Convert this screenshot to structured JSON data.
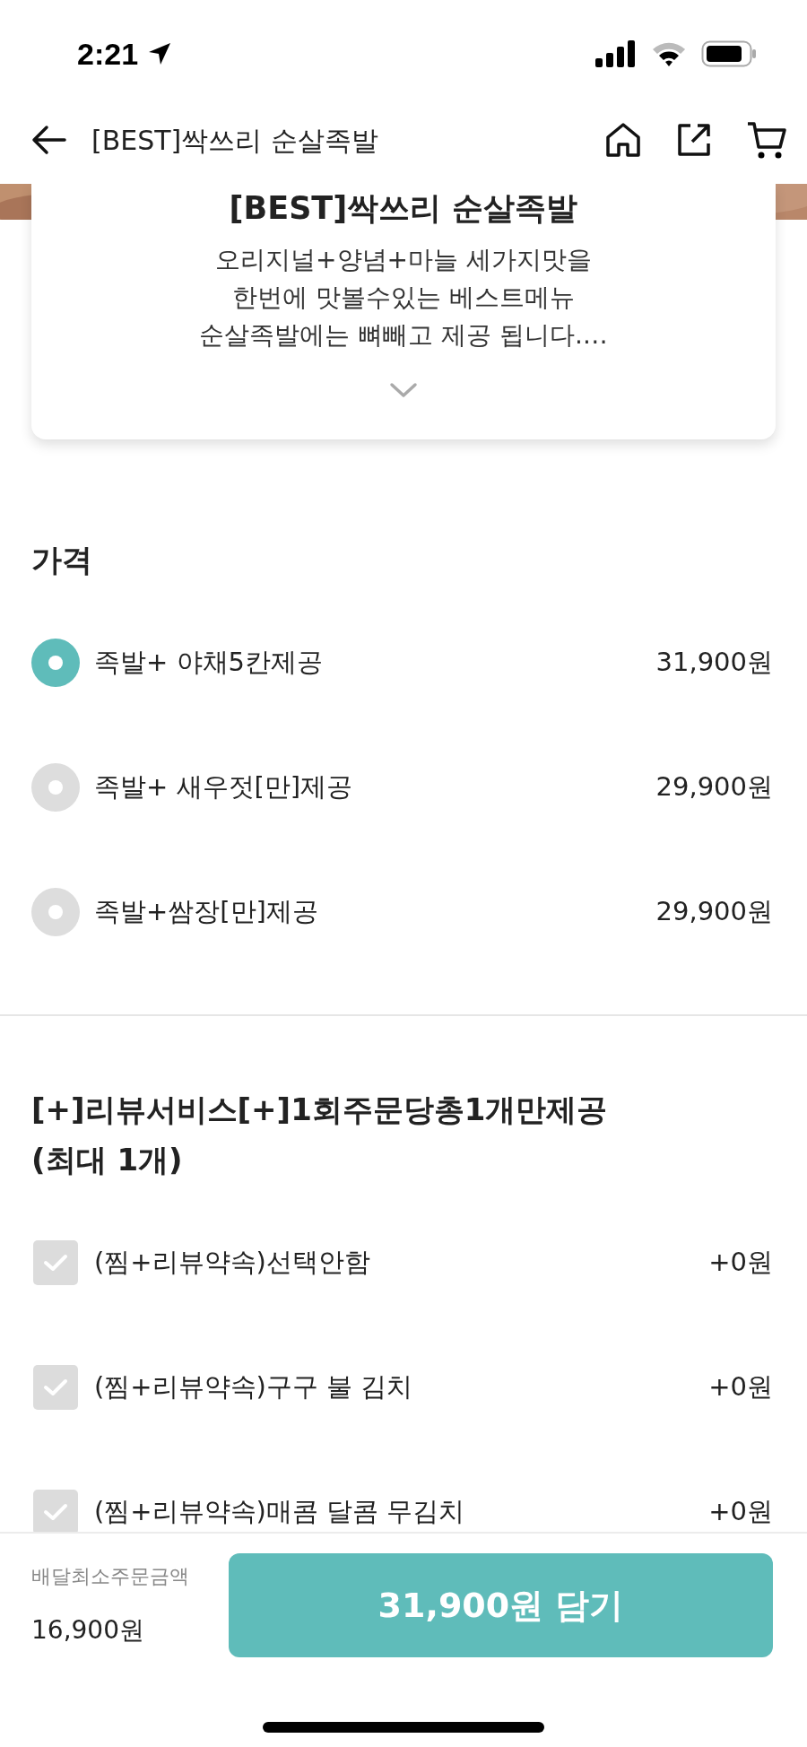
{
  "status_bar": {
    "time": "2:21"
  },
  "header": {
    "title": "[BEST]싹쓰리 순살족발"
  },
  "menu_card": {
    "title": "[BEST]싹쓰리 순살족발",
    "description": [
      "오리지널+양념+마늘 세가지맛을",
      "한번에 맛볼수있는 베스트메뉴",
      "순살족발에는 뼈빼고 제공 됩니다.…"
    ],
    "expanded": false
  },
  "option_groups": [
    {
      "kind": "radio",
      "title": "가격",
      "options": [
        {
          "label": "족발+ 야채5칸제공",
          "price": "31,900원",
          "selected": true
        },
        {
          "label": "족발+ 새우젓[만]제공",
          "price": "29,900원",
          "selected": false
        },
        {
          "label": "족발+쌈장[만]제공",
          "price": "29,900원",
          "selected": false
        }
      ]
    },
    {
      "kind": "checkbox",
      "title": "[+]리뷰서비스[+]1회주문당총1개만제공",
      "limit": "(최대 1개)",
      "options": [
        {
          "label": "(찜+리뷰약속)선택안함",
          "price": "+0원",
          "checked": false
        },
        {
          "label": "(찜+리뷰약속)구구 불 김치",
          "price": "+0원",
          "checked": false
        },
        {
          "label": "(찜+리뷰약속)매콤 달콤 무김치",
          "price": "+0원",
          "checked": false
        }
      ]
    }
  ],
  "footer": {
    "min_order_label": "배달최소주문금액",
    "min_order_amount": "16,900원",
    "add_button": "31,900원 담기"
  }
}
